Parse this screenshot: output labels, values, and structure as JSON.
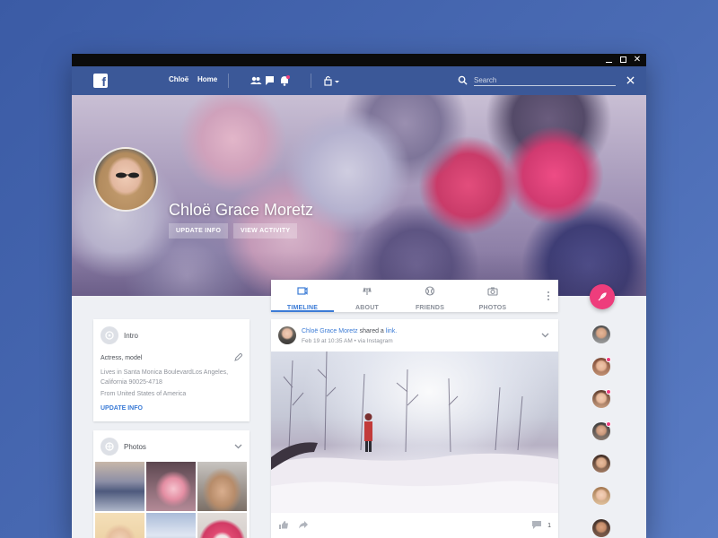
{
  "window": {
    "controls": [
      "minimize",
      "maximize",
      "close"
    ]
  },
  "navbar": {
    "logo": "f",
    "links": [
      "Chloë",
      "Home"
    ],
    "search_placeholder": "Search",
    "search_value": ""
  },
  "profile": {
    "name": "Chloë Grace Moretz",
    "update_info_label": "UPDATE INFO",
    "view_activity_label": "VIEW ACTIVITY"
  },
  "tabs": [
    {
      "label": "TIMELINE",
      "icon": "timeline-icon",
      "active": true
    },
    {
      "label": "ABOUT",
      "icon": "about-icon",
      "active": false
    },
    {
      "label": "FRIENDS",
      "icon": "friends-icon",
      "active": false
    },
    {
      "label": "PHOTOS",
      "icon": "camera-icon",
      "active": false
    }
  ],
  "intro": {
    "title": "Intro",
    "occupation": "Actress, model",
    "lives_in_1": "Lives in Santa Monica BoulevardLos Angeles,",
    "lives_in_2": "California 90025-4718",
    "from": "From United States of America",
    "update_label": "UPDATE INFO"
  },
  "photos": {
    "title": "Photos"
  },
  "post": {
    "author": "Chloë Grace Moretz",
    "action": " shared a ",
    "object": "link.",
    "meta": "Feb 19 at 10:35 AM • via Instagram",
    "comment_count": "1"
  },
  "colors": {
    "brand": "#3b5898",
    "accent": "#3b7bd6",
    "fab": "#ee3d7c"
  }
}
